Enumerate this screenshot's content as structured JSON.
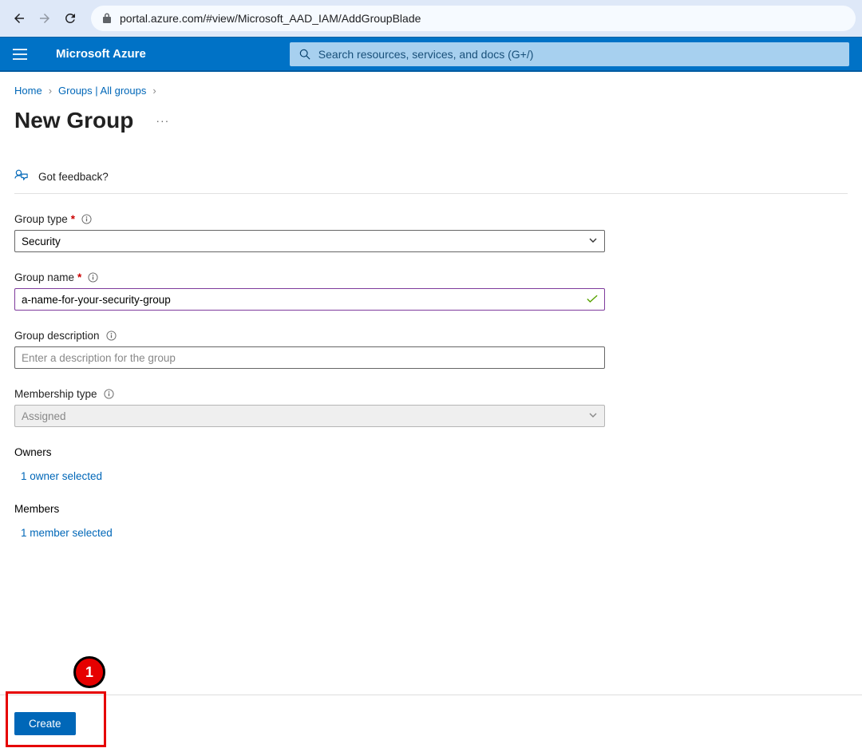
{
  "browser": {
    "url": "portal.azure.com/#view/Microsoft_AAD_IAM/AddGroupBlade"
  },
  "topbar": {
    "brand": "Microsoft Azure",
    "search_placeholder": "Search resources, services, and docs (G+/)"
  },
  "breadcrumb": {
    "home": "Home",
    "groups": "Groups | All groups"
  },
  "page": {
    "title": "New Group",
    "feedback": "Got feedback?"
  },
  "form": {
    "group_type_label": "Group type",
    "group_type_value": "Security",
    "group_name_label": "Group name",
    "group_name_value": "a-name-for-your-security-group",
    "group_desc_label": "Group description",
    "group_desc_placeholder": "Enter a description for the group",
    "membership_type_label": "Membership type",
    "membership_type_value": "Assigned",
    "owners_label": "Owners",
    "owners_selected": "1 owner selected",
    "members_label": "Members",
    "members_selected": "1 member selected"
  },
  "footer": {
    "create": "Create"
  },
  "annotation": {
    "number": "1"
  }
}
